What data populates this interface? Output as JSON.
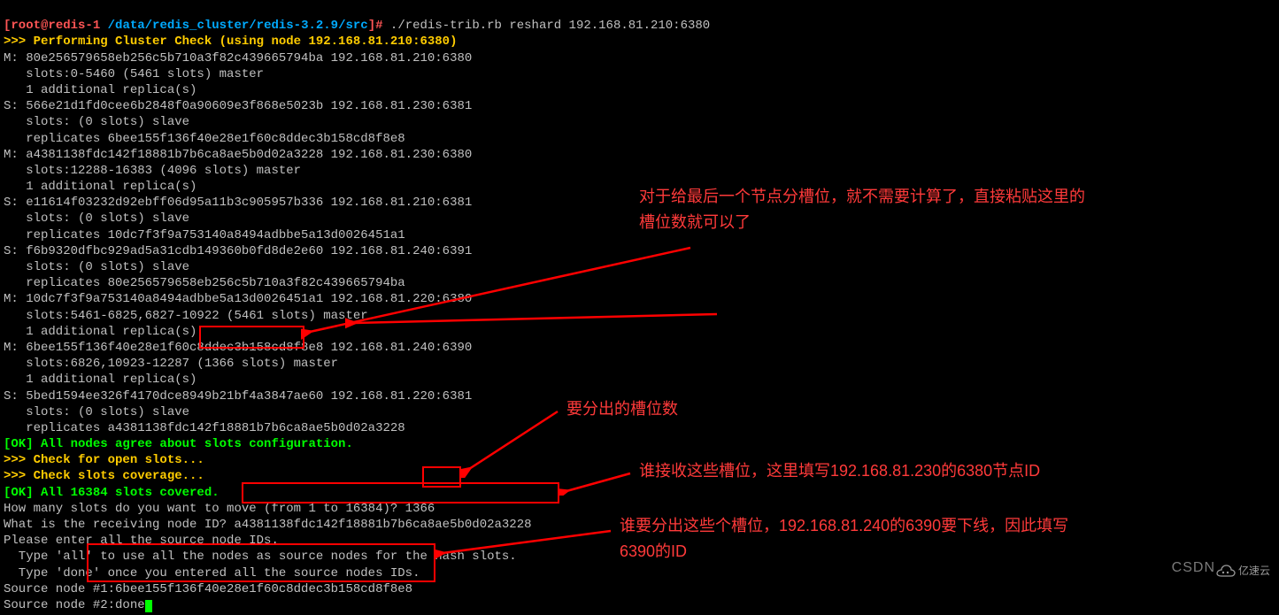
{
  "prompt": {
    "open": "[",
    "host": "root@redis-1",
    "sep": " ",
    "path": "/data/redis_cluster/redis-3.2.9/src",
    "close": "]#",
    "command": " ./redis-trib.rb reshard 192.168.81.210:6380"
  },
  "lines": {
    "l1": ">>> Performing Cluster Check (using node 192.168.81.210:6380)",
    "l2": "M: 80e256579658eb256c5b710a3f82c439665794ba 192.168.81.210:6380",
    "l3": "   slots:0-5460 (5461 slots) master",
    "l4": "   1 additional replica(s)",
    "l5": "S: 566e21d1fd0cee6b2848f0a90609e3f868e5023b 192.168.81.230:6381",
    "l6": "   slots: (0 slots) slave",
    "l7": "   replicates 6bee155f136f40e28e1f60c8ddec3b158cd8f8e8",
    "l8": "M: a4381138fdc142f18881b7b6ca8ae5b0d02a3228 192.168.81.230:6380",
    "l9": "   slots:12288-16383 (4096 slots) master",
    "l10": "   1 additional replica(s)",
    "l11": "S: e11614f03232d92ebff06d95a11b3c905957b336 192.168.81.210:6381",
    "l12": "   slots: (0 slots) slave",
    "l13": "   replicates 10dc7f3f9a753140a8494adbbe5a13d0026451a1",
    "l14": "S: f6b9320dfbc929ad5a31cdb149360b0fd8de2e60 192.168.81.240:6391",
    "l15": "   slots: (0 slots) slave",
    "l16": "   replicates 80e256579658eb256c5b710a3f82c439665794ba",
    "l17": "M: 10dc7f3f9a753140a8494adbbe5a13d0026451a1 192.168.81.220:6380",
    "l18": "   slots:5461-6825,6827-10922 (5461 slots) master",
    "l19": "   1 additional replica(s)",
    "l20": "M: 6bee155f136f40e28e1f60c8ddec3b158cd8f8e8 192.168.81.240:6390",
    "l21": "   slots:6826,10923-12287 (1366 slots) master",
    "l22": "   1 additional replica(s)",
    "l23": "S: 5bed1594ee326f4170dce8949b21bf4a3847ae60 192.168.81.220:6381",
    "l24": "   slots: (0 slots) slave",
    "l25": "   replicates a4381138fdc142f18881b7b6ca8ae5b0d02a3228",
    "l26": "[OK] All nodes agree about slots configuration.",
    "l27": ">>> Check for open slots...",
    "l28": ">>> Check slots coverage...",
    "l29": "[OK] All 16384 slots covered.",
    "l30": "How many slots do you want to move (from 1 to 16384)? 1366",
    "l31": "What is the receiving node ID? a4381138fdc142f18881b7b6ca8ae5b0d02a3228",
    "l32": "Please enter all the source node IDs.",
    "l33": "  Type 'all' to use all the nodes as source nodes for the hash slots.",
    "l34": "  Type 'done' once you entered all the source nodes IDs.",
    "l35": "Source node #1:6bee155f136f40e28e1f60c8ddec3b158cd8f8e8",
    "l36": "Source node #2:done"
  },
  "annotations": {
    "a1": "对于给最后一个节点分槽位，就不需要计算了，直接粘贴这里的\n槽位数就可以了",
    "a2": "要分出的槽位数",
    "a3": "谁接收这些槽位，这里填写192.168.81.230的6380节点ID",
    "a4": "谁要分出这些个槽位，192.168.81.240的6390要下线，因此填写\n6390的ID"
  },
  "watermark": "CSDN",
  "logo_text": "亿速云"
}
